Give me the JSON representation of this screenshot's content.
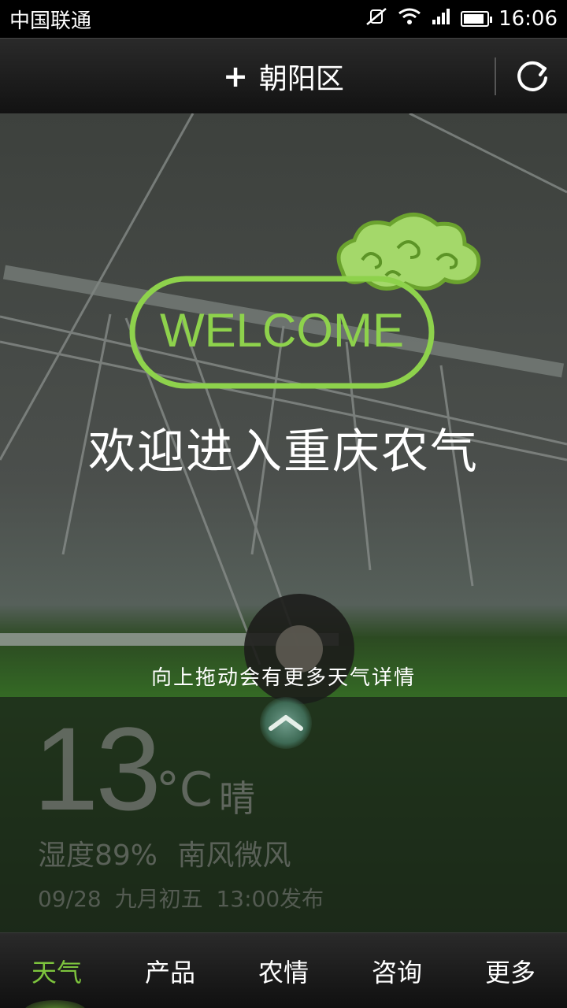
{
  "status_bar": {
    "carrier": "中国联通",
    "time": "16:06",
    "icons": [
      "mute-icon",
      "wifi-icon",
      "signal-icon",
      "battery-icon"
    ],
    "battery_level": 0.9
  },
  "header": {
    "location": "朝阳区",
    "add_icon": "+",
    "refresh_icon": "refresh-icon"
  },
  "welcome": {
    "badge_text": "WELCOME",
    "title": "欢迎进入重庆农气",
    "drag_hint": "向上拖动会有更多天气详情"
  },
  "weather": {
    "temperature": "13",
    "unit": "°C",
    "condition": "晴",
    "humidity_wind": "湿度89%  南风微风",
    "publish_info": "09/28  九月初五  13:00发布"
  },
  "nav": {
    "tabs": [
      {
        "label": "天气",
        "active": true
      },
      {
        "label": "产品",
        "active": false
      },
      {
        "label": "农情",
        "active": false
      },
      {
        "label": "咨询",
        "active": false
      },
      {
        "label": "更多",
        "active": false
      }
    ]
  },
  "colors": {
    "accent": "#7dc43d",
    "badge_green": "#8ed24c"
  }
}
